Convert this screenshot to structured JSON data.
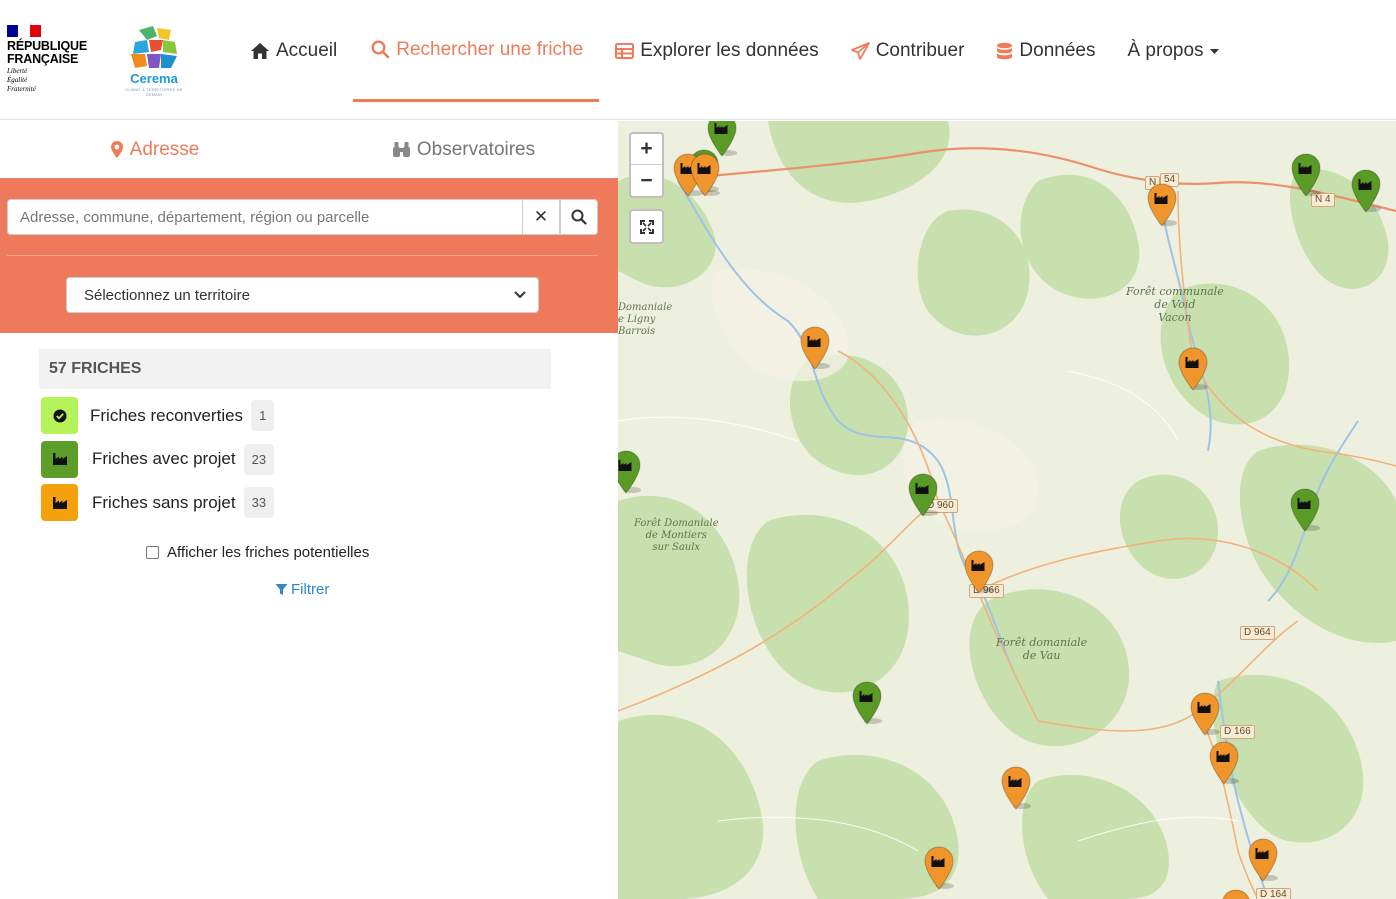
{
  "header": {
    "rf": {
      "line1": "RÉPUBLIQUE",
      "line2": "FRANÇAISE",
      "motto1": "Liberté",
      "motto2": "Égalité",
      "motto3": "Fraternité"
    },
    "cerema": {
      "name": "Cerema",
      "sub": "CLIMAT & TERRITOIRES DE DEMAIN"
    },
    "nav": [
      {
        "label": "Accueil",
        "icon": "home-icon"
      },
      {
        "label": "Rechercher une friche",
        "icon": "search-icon",
        "active": true
      },
      {
        "label": "Explorer les données",
        "icon": "table-icon"
      },
      {
        "label": "Contribuer",
        "icon": "paper-plane-icon"
      },
      {
        "label": "Données",
        "icon": "database-icon"
      },
      {
        "label": "À propos",
        "icon": "caret-down-icon"
      }
    ]
  },
  "panel": {
    "tabs": [
      {
        "label": "Adresse",
        "icon": "map-marker-icon",
        "active": true
      },
      {
        "label": "Observatoires",
        "icon": "binoculars-icon"
      }
    ],
    "search": {
      "placeholder": "Adresse, commune, département, région ou parcelle",
      "clear": "✕"
    },
    "territory_select": {
      "value": "Sélectionnez un territoire"
    },
    "count_label": "57 FRICHES",
    "legend": [
      {
        "label": "Friches reconverties",
        "count": "1",
        "color": "#b5f35b"
      },
      {
        "label": "Friches avec projet",
        "count": "23",
        "color": "#5d9e2a"
      },
      {
        "label": "Friches sans projet",
        "count": "33",
        "color": "#f4a10d"
      }
    ],
    "potential_checkbox": "Afficher les friches potentielles",
    "filter_label": "Filtrer"
  },
  "map": {
    "zoom_in": "+",
    "zoom_out": "−",
    "labels": {
      "void": "Forêt communale\nde Void\nVacon",
      "montiers": "Forêt Domaniale\nde Montiers\nsur Saulx",
      "vau": "Forêt domaniale\nde Vau",
      "ligny": "Domaniale\ne Ligny\nBarrois"
    },
    "roads": {
      "n4": "N 4",
      "n4b": "N",
      "n54": "54",
      "d960": "D 960",
      "d966": "D 966",
      "d964": "D 964",
      "d166": "D 166",
      "d164": "D 164"
    },
    "colors": {
      "orange": "#f0952c",
      "green": "#5a9b25"
    }
  }
}
